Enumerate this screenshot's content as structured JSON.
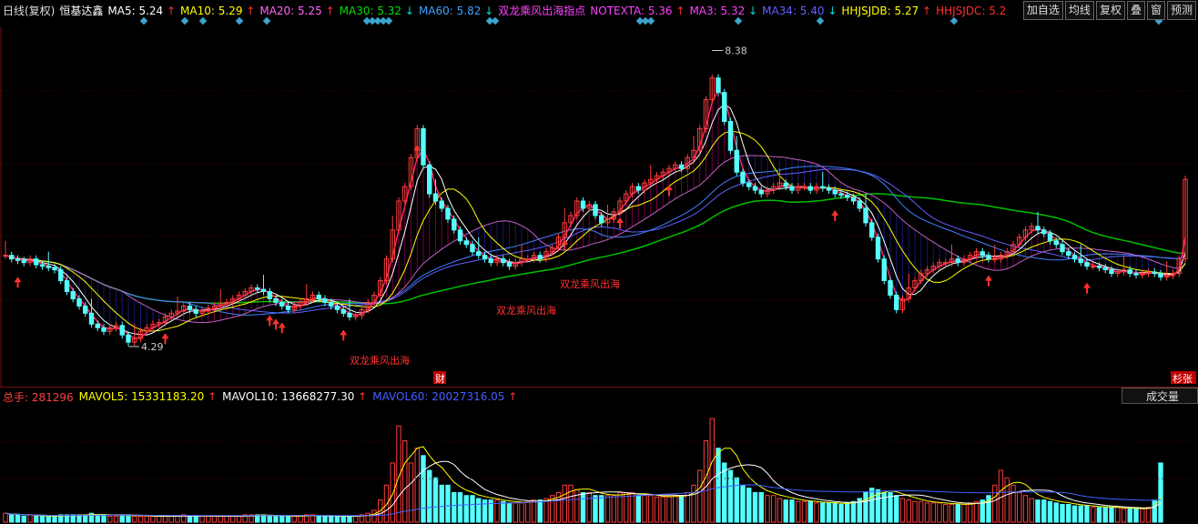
{
  "header": {
    "period": "日线(复权)",
    "stock_name": "恒基达鑫",
    "indicators": [
      {
        "label": "MA5: 5.24",
        "arrow": "↑",
        "color": "#ffffff",
        "arrow_color": "#ff3030"
      },
      {
        "label": "MA10: 5.29",
        "arrow": "↑",
        "color": "#ffff00",
        "arrow_color": "#ff3030"
      },
      {
        "label": "MA20: 5.25",
        "arrow": "↑",
        "color": "#ff66ff",
        "arrow_color": "#ff3030"
      },
      {
        "label": "MA30: 5.32",
        "arrow": "↓",
        "color": "#00e000",
        "arrow_color": "#00e0e0"
      },
      {
        "label": "MA60: 5.82",
        "arrow": "↓",
        "color": "#40a0ff",
        "arrow_color": "#00e0e0"
      },
      {
        "label": "双龙乘风出海指点",
        "arrow": "",
        "color": "#ff40ff",
        "arrow_color": "#ff3030"
      },
      {
        "label": "NOTEXTA: 5.36",
        "arrow": "↑",
        "color": "#ff40ff",
        "arrow_color": "#ff3030"
      },
      {
        "label": "MA3: 5.32",
        "arrow": "↓",
        "color": "#ff40ff",
        "arrow_color": "#00e0e0"
      },
      {
        "label": "MA34: 5.40",
        "arrow": "↓",
        "color": "#6060ff",
        "arrow_color": "#00e0e0"
      },
      {
        "label": "HHJSJDB: 5.27",
        "arrow": "↑",
        "color": "#ffff00",
        "arrow_color": "#ff3030"
      },
      {
        "label": "HHJSJDC: 5.2",
        "arrow": "",
        "color": "#ff3030",
        "arrow_color": "#ff3030"
      }
    ]
  },
  "toolbar": {
    "buttons": [
      "加自选",
      "均线",
      "复权",
      "叠",
      "窗",
      "预测"
    ]
  },
  "chart_data": {
    "type": "candlestick",
    "price_high_label": "8.38",
    "price_low_label": "4.29",
    "signal_text": "双龙乘风出海",
    "marker_cai": "财",
    "marker_right": "杉张",
    "close": [
      5.55,
      5.5,
      5.48,
      5.45,
      5.5,
      5.42,
      5.4,
      5.38,
      5.35,
      5.2,
      5.05,
      4.95,
      4.85,
      4.75,
      4.6,
      4.55,
      4.5,
      4.55,
      4.58,
      4.45,
      4.35,
      4.4,
      4.5,
      4.55,
      4.6,
      4.62,
      4.7,
      4.75,
      4.78,
      4.85,
      4.8,
      4.75,
      4.78,
      4.82,
      4.85,
      4.88,
      4.9,
      4.95,
      5.0,
      5.05,
      5.1,
      5.08,
      5.05,
      4.95,
      4.9,
      4.85,
      4.8,
      4.85,
      4.9,
      4.95,
      5.0,
      4.95,
      4.9,
      4.85,
      4.8,
      4.75,
      4.7,
      4.72,
      4.8,
      4.9,
      5.0,
      5.2,
      5.5,
      5.9,
      6.3,
      6.5,
      6.9,
      7.3,
      6.8,
      6.4,
      6.3,
      6.2,
      6.05,
      5.9,
      5.75,
      5.7,
      5.6,
      5.55,
      5.5,
      5.45,
      5.5,
      5.45,
      5.4,
      5.45,
      5.5,
      5.5,
      5.55,
      5.5,
      5.6,
      5.65,
      5.8,
      6.0,
      6.1,
      6.3,
      6.2,
      6.25,
      6.1,
      6.0,
      6.05,
      6.15,
      6.3,
      6.4,
      6.5,
      6.45,
      6.55,
      6.6,
      6.65,
      6.7,
      6.75,
      6.8,
      6.75,
      6.9,
      7.0,
      7.3,
      7.7,
      8.0,
      7.8,
      7.4,
      7.0,
      6.7,
      6.55,
      6.5,
      6.45,
      6.4,
      6.45,
      6.5,
      6.55,
      6.5,
      6.45,
      6.5,
      6.5,
      6.45,
      6.5,
      6.48,
      6.45,
      6.4,
      6.38,
      6.35,
      6.3,
      6.2,
      6.0,
      5.8,
      5.5,
      5.2,
      5.0,
      4.8,
      4.95,
      5.1,
      5.2,
      5.3,
      5.35,
      5.4,
      5.45,
      5.45,
      5.5,
      5.45,
      5.5,
      5.55,
      5.6,
      5.55,
      5.5,
      5.5,
      5.55,
      5.6,
      5.7,
      5.8,
      5.9,
      5.95,
      5.9,
      5.85,
      5.75,
      5.7,
      5.6,
      5.55,
      5.5,
      5.45,
      5.4,
      5.4,
      5.38,
      5.35,
      5.3,
      5.32,
      5.35,
      5.3,
      5.28,
      5.3,
      5.32,
      5.3,
      5.25,
      5.27,
      5.3,
      5.5,
      6.6
    ],
    "volume": [
      0.6,
      0.5,
      0.5,
      0.4,
      0.5,
      0.4,
      0.4,
      0.4,
      0.4,
      0.5,
      0.5,
      0.5,
      0.5,
      0.5,
      0.6,
      0.5,
      0.5,
      0.4,
      0.4,
      0.5,
      0.5,
      0.4,
      0.4,
      0.4,
      0.4,
      0.4,
      0.4,
      0.4,
      0.4,
      0.5,
      0.4,
      0.4,
      0.4,
      0.4,
      0.4,
      0.4,
      0.4,
      0.4,
      0.4,
      0.5,
      0.5,
      0.5,
      0.5,
      0.4,
      0.4,
      0.4,
      0.4,
      0.4,
      0.4,
      0.5,
      0.5,
      0.4,
      0.4,
      0.4,
      0.4,
      0.4,
      0.4,
      0.4,
      0.5,
      0.6,
      0.8,
      1.5,
      2.5,
      4.0,
      6.5,
      5.5,
      4.0,
      5.0,
      4.5,
      3.5,
      3.0,
      2.5,
      2.5,
      2.0,
      2.0,
      1.8,
      1.8,
      1.6,
      1.5,
      1.5,
      1.5,
      1.4,
      1.3,
      1.3,
      1.3,
      1.4,
      1.5,
      1.5,
      1.6,
      1.8,
      2.0,
      2.5,
      2.5,
      2.2,
      2.0,
      2.0,
      1.8,
      1.8,
      1.8,
      1.8,
      2.0,
      2.0,
      2.0,
      1.8,
      1.8,
      1.8,
      1.7,
      1.7,
      1.7,
      1.8,
      1.8,
      2.0,
      2.5,
      3.5,
      5.5,
      7.0,
      5.0,
      4.0,
      3.5,
      3.0,
      2.5,
      2.3,
      2.0,
      2.0,
      1.8,
      1.8,
      1.6,
      1.5,
      1.5,
      1.4,
      1.4,
      1.4,
      1.3,
      1.3,
      1.3,
      1.3,
      1.2,
      1.3,
      1.4,
      1.6,
      2.0,
      2.3,
      2.2,
      2.0,
      2.0,
      1.8,
      1.6,
      1.5,
      1.4,
      1.4,
      1.3,
      1.3,
      1.3,
      1.2,
      1.2,
      1.2,
      1.2,
      1.3,
      1.4,
      1.5,
      1.8,
      2.5,
      3.5,
      3.0,
      2.5,
      2.0,
      1.8,
      1.6,
      1.5,
      1.5,
      1.4,
      1.3,
      1.2,
      1.2,
      1.1,
      1.1,
      1.1,
      1.0,
      1.0,
      1.0,
      1.0,
      1.0,
      0.9,
      0.9,
      0.9,
      0.9,
      1.0,
      1.5,
      4.0
    ]
  },
  "volume_panel": {
    "total_hands": "总手: 281296",
    "indicators": [
      {
        "label": "MAVOL5: 15331183.20",
        "arrow": "↑",
        "color": "#ffff00"
      },
      {
        "label": "MAVOL10: 13668277.30",
        "arrow": "↑",
        "color": "#ffffff"
      },
      {
        "label": "MAVOL60: 20027316.05",
        "arrow": "↑",
        "color": "#4060ff"
      }
    ],
    "dropdown_label": "成交量"
  }
}
